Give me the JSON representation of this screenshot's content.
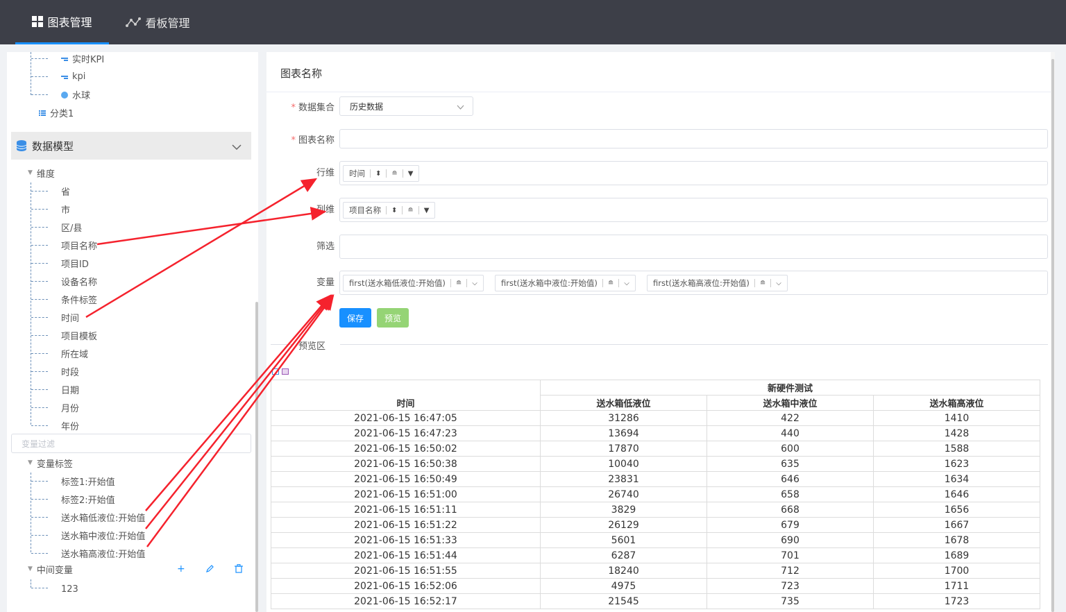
{
  "topbar": {
    "tabs": [
      {
        "label": "图表管理",
        "active": true
      },
      {
        "label": "看板管理",
        "active": false
      }
    ]
  },
  "left": {
    "chart_tree": {
      "items": [
        "实时KPI",
        "kpi",
        "水球"
      ],
      "category": "分类1"
    },
    "model_header": "数据模型",
    "dimension_group": "维度",
    "dimensions": [
      "省",
      "市",
      "区/县",
      "项目名称",
      "项目ID",
      "设备名称",
      "条件标签",
      "时间",
      "项目模板",
      "所在域",
      "时段",
      "日期",
      "月份",
      "年份"
    ],
    "filter_placeholder": "变量过滤",
    "var_group": "变量标签",
    "variables": [
      "标签1:开始值",
      "标签2:开始值",
      "送水箱低液位:开始值",
      "送水箱中液位:开始值",
      "送水箱高液位:开始值"
    ],
    "mid_group": "中间变量",
    "mid_items": [
      "123"
    ]
  },
  "form": {
    "card_title": "图表名称",
    "dataset_label": "数据集合",
    "dataset_value": "历史数据",
    "name_label": "图表名称",
    "name_value": "",
    "row_label": "行维",
    "row_chip": "时间",
    "col_label": "列维",
    "col_chip": "项目名称",
    "filter_label": "筛选",
    "var_label": "变量",
    "var_chips": [
      "first(送水箱低液位:开始值)",
      "first(送水箱中液位:开始值)",
      "first(送水箱高液位:开始值)"
    ],
    "save_label": "保存",
    "preview_label": "预览",
    "preview_area": "预览区"
  },
  "table": {
    "group_header": "新硬件测试",
    "headers": [
      "时间",
      "送水箱低液位",
      "送水箱中液位",
      "送水箱高液位"
    ],
    "rows": [
      [
        "2021-06-15 16:47:05",
        "31286",
        "422",
        "1410"
      ],
      [
        "2021-06-15 16:47:23",
        "13694",
        "440",
        "1428"
      ],
      [
        "2021-06-15 16:50:02",
        "17870",
        "600",
        "1588"
      ],
      [
        "2021-06-15 16:50:38",
        "10040",
        "635",
        "1623"
      ],
      [
        "2021-06-15 16:50:49",
        "23831",
        "646",
        "1634"
      ],
      [
        "2021-06-15 16:51:00",
        "26740",
        "658",
        "1646"
      ],
      [
        "2021-06-15 16:51:11",
        "3829",
        "668",
        "1656"
      ],
      [
        "2021-06-15 16:51:22",
        "26129",
        "679",
        "1667"
      ],
      [
        "2021-06-15 16:51:33",
        "5601",
        "690",
        "1678"
      ],
      [
        "2021-06-15 16:51:44",
        "6287",
        "701",
        "1689"
      ],
      [
        "2021-06-15 16:51:55",
        "18240",
        "712",
        "1700"
      ],
      [
        "2021-06-15 16:52:06",
        "4975",
        "723",
        "1711"
      ],
      [
        "2021-06-15 16:52:17",
        "21545",
        "735",
        "1723"
      ]
    ]
  },
  "colors": {
    "topbar": "#3d3f48",
    "accent": "#1890ff",
    "preview_button": "#95d475",
    "annotation_arrow": "#f5222d"
  }
}
